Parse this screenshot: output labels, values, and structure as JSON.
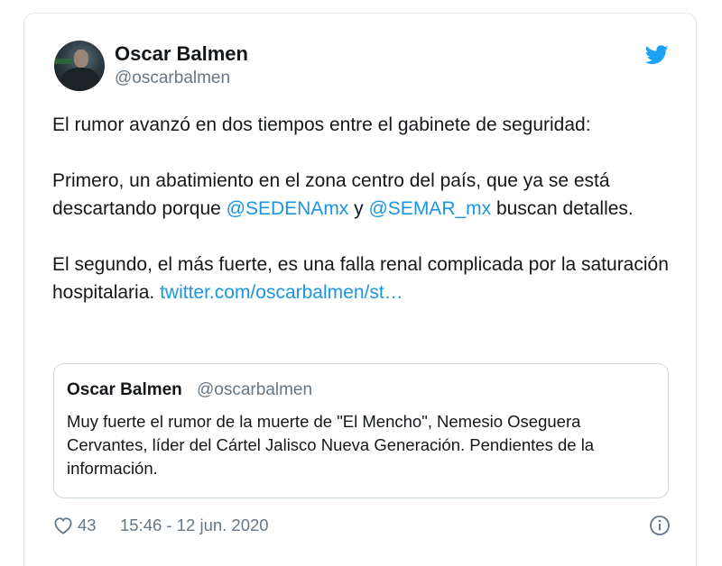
{
  "tweet": {
    "author_name": "Oscar Balmen",
    "author_handle": "@oscarbalmen",
    "paragraph_1": "El rumor avanzó en dos tiempos entre el gabinete de seguridad:",
    "paragraph_2_a": "Primero, un abatimiento en el zona centro del país, que ya se está descartando porque ",
    "mention_1": "@SEDENAmx",
    "paragraph_2_b": " y ",
    "mention_2": "@SEMAR_mx",
    "paragraph_2_c": " buscan detalles.",
    "paragraph_3": "El segundo, el más fuerte, es una falla renal complicada por la saturación hospitalaria. ",
    "link_text": "twitter.com/oscarbalmen/st…"
  },
  "quoted_tweet": {
    "author_name": "Oscar Balmen",
    "author_handle": "@oscarbalmen",
    "text": "Muy fuerte el rumor de la muerte de \"El Mencho\", Nemesio Oseguera Cervantes, líder del Cártel Jalisco Nueva Generación. Pendientes de la información."
  },
  "footer": {
    "likes": "43",
    "timestamp": "15:46 - 12 jun. 2020"
  },
  "icons": {
    "brand": "twitter-bird-icon",
    "like": "heart-icon",
    "info": "info-icon"
  },
  "colors": {
    "link": "#1b95e0",
    "brand": "#1da1f2",
    "muted": "#657786",
    "border": "#e1e8ed"
  }
}
